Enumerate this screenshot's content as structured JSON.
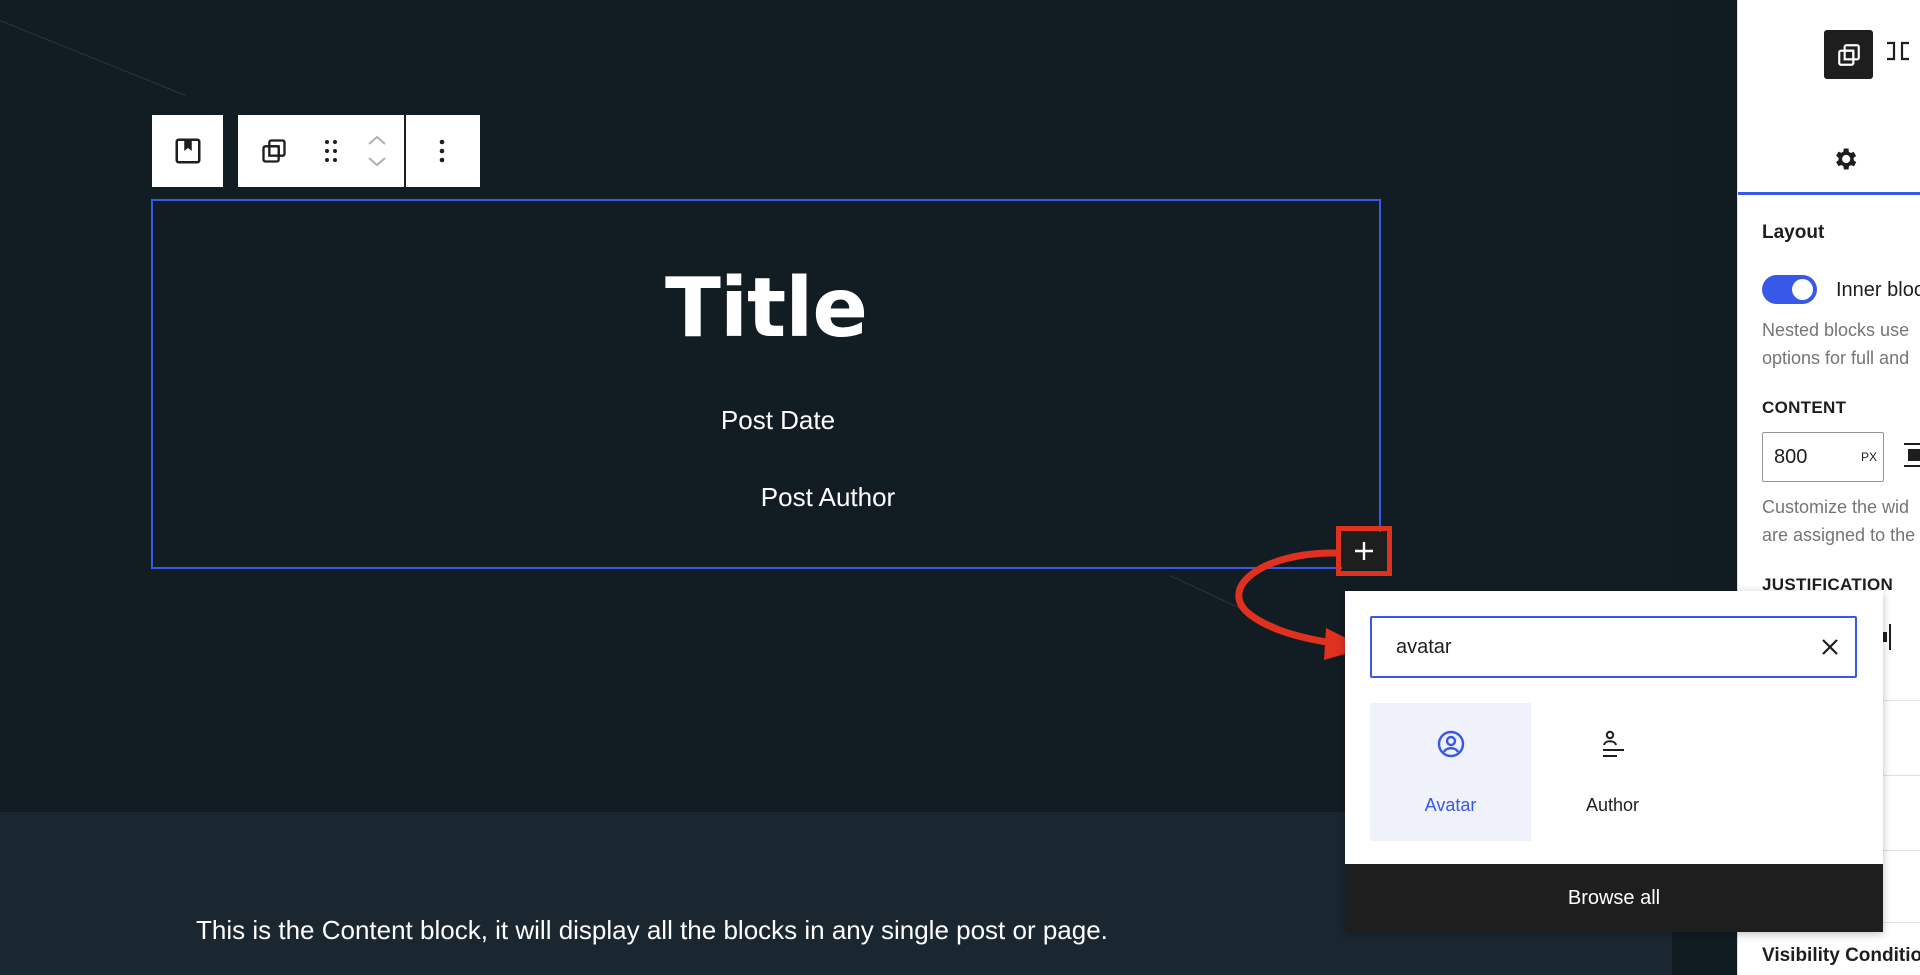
{
  "canvas": {
    "block": {
      "title": "Title",
      "post_date": "Post Date",
      "post_author": "Post Author"
    },
    "content_text": "This is the Content block, it will display all the blocks in any single post or page."
  },
  "sidebar": {
    "section_title": "Layout",
    "toggle_label": "Inner bloc",
    "toggle_on": true,
    "toggle_help_1": "Nested blocks use",
    "toggle_help_2": "options for full and",
    "content_label": "CONTENT",
    "content_value": "800",
    "content_unit": "PX",
    "content_help_1": "Customize the wid",
    "content_help_2": "are assigned to the",
    "justification_label": "JUSTIFICATION",
    "visibility_label": "Visibility Conditio"
  },
  "inserter": {
    "search_value": "avatar",
    "results": [
      {
        "label": "Avatar",
        "icon": "avatar-icon",
        "active": true
      },
      {
        "label": "Author",
        "icon": "author-icon",
        "active": false
      }
    ],
    "browse_all_label": "Browse all"
  },
  "colors": {
    "accent": "#3858e9",
    "annotation": "#e0301e",
    "canvas_bg": "#121c23",
    "dark_ui": "#1e1e1e"
  }
}
